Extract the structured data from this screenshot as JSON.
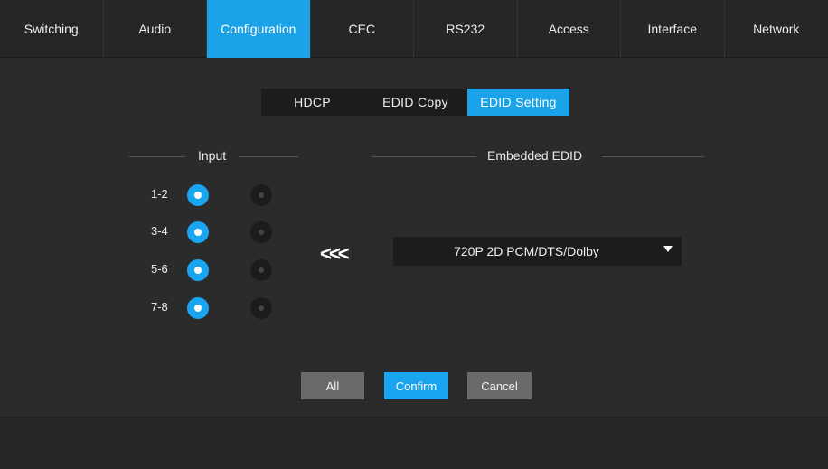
{
  "nav": {
    "tabs": [
      {
        "label": "Switching"
      },
      {
        "label": "Audio"
      },
      {
        "label": "Configuration"
      },
      {
        "label": "CEC"
      },
      {
        "label": "RS232"
      },
      {
        "label": "Access"
      },
      {
        "label": "Interface"
      },
      {
        "label": "Network"
      }
    ],
    "active": "Configuration"
  },
  "subtabs": {
    "items": [
      {
        "label": "HDCP"
      },
      {
        "label": "EDID Copy"
      },
      {
        "label": "EDID Setting"
      }
    ],
    "active": "EDID Setting"
  },
  "input_section": {
    "title": "Input",
    "rows": [
      {
        "label": "1-2",
        "left_selected": true,
        "right_selected": false
      },
      {
        "label": "3-4",
        "left_selected": true,
        "right_selected": false
      },
      {
        "label": "5-6",
        "left_selected": true,
        "right_selected": false
      },
      {
        "label": "7-8",
        "left_selected": true,
        "right_selected": false
      }
    ]
  },
  "edid_section": {
    "title": "Embedded EDID",
    "arrows": "<<<",
    "selected_value": "720P 2D PCM/DTS/Dolby"
  },
  "buttons": {
    "all": "All",
    "confirm": "Confirm",
    "cancel": "Cancel"
  },
  "colors": {
    "accent": "#1aa3e8",
    "background": "#2b2b2b",
    "bar": "#262626",
    "control": "#1c1c1c",
    "button_gray": "#6a6a6a"
  }
}
